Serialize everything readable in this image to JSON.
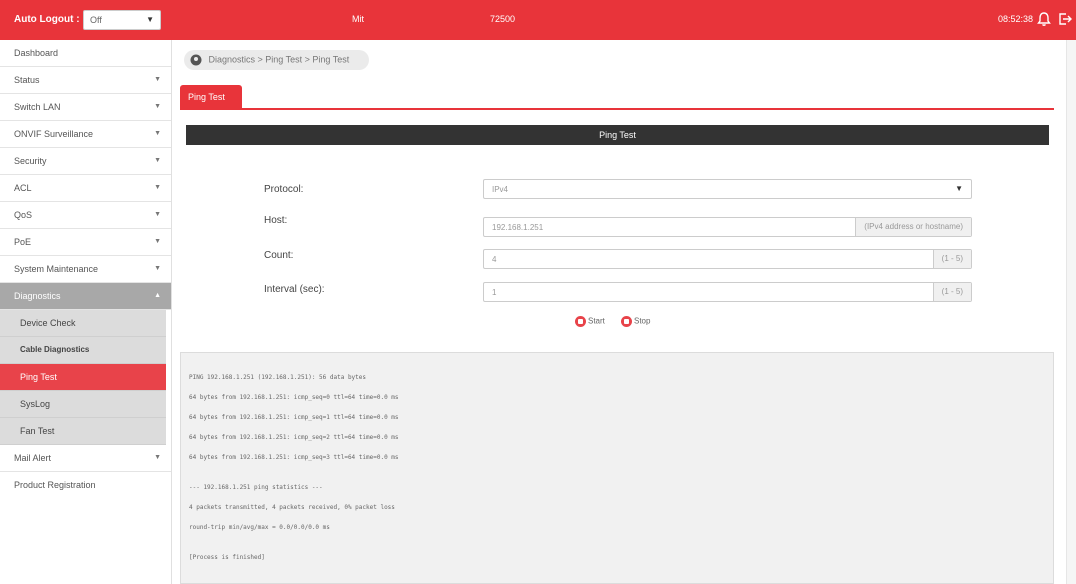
{
  "topbar": {
    "logout_label": "Auto Logout :",
    "logout_value": "Off",
    "model": "Mit",
    "serial": "72500",
    "time": "08:52:38"
  },
  "sidebar": {
    "items": [
      {
        "label": "Dashboard"
      },
      {
        "label": "Status"
      },
      {
        "label": "Switch LAN"
      },
      {
        "label": "ONVIF Surveillance"
      },
      {
        "label": "Security"
      },
      {
        "label": "ACL"
      },
      {
        "label": "QoS"
      },
      {
        "label": "PoE"
      },
      {
        "label": "System Maintenance"
      },
      {
        "label": "Diagnostics"
      },
      {
        "label": "Device Check"
      },
      {
        "label": "Cable Diagnostics"
      },
      {
        "label": "Ping Test"
      },
      {
        "label": "SysLog"
      },
      {
        "label": "Fan Test"
      },
      {
        "label": "Mail Alert"
      },
      {
        "label": "Product Registration"
      }
    ]
  },
  "breadcrumb": "Diagnostics > Ping Test > Ping Test",
  "tab_label": "Ping Test",
  "section_title": "Ping Test",
  "form": {
    "protocol_label": "Protocol:",
    "protocol_value": "IPv4",
    "host_label": "Host:",
    "host_value": "192.168.1.251",
    "host_hint": "(IPv4 address or hostname)",
    "count_label": "Count:",
    "count_value": "4",
    "count_hint": "(1 - 5)",
    "interval_label": "Interval (sec):",
    "interval_value": "1",
    "interval_hint": "(1 - 5)"
  },
  "buttons": {
    "start": "Start",
    "stop": "Stop"
  },
  "console": {
    "lines": [
      "PING 192.168.1.251 (192.168.1.251): 56 data bytes",
      "64 bytes from 192.168.1.251: icmp_seq=0 ttl=64 time=0.0 ms",
      "64 bytes from 192.168.1.251: icmp_seq=1 ttl=64 time=0.0 ms",
      "64 bytes from 192.168.1.251: icmp_seq=2 ttl=64 time=0.0 ms",
      "64 bytes from 192.168.1.251: icmp_seq=3 ttl=64 time=0.0 ms",
      "",
      "--- 192.168.1.251 ping statistics ---",
      "4 packets transmitted, 4 packets received, 0% packet loss",
      "round-trip min/avg/max = 0.0/0.0/0.0 ms",
      "",
      "[Process is finished]"
    ]
  },
  "colors": {
    "accent": "#e8343a",
    "section_bar": "#333333"
  }
}
